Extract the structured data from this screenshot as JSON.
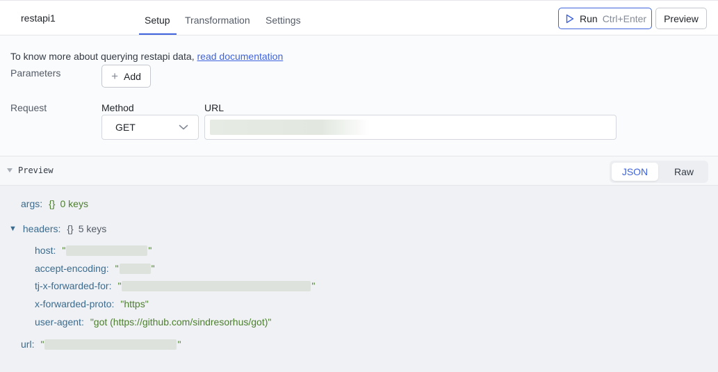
{
  "header": {
    "query_name": "restapi1",
    "tabs": [
      {
        "label": "Setup",
        "active": true
      },
      {
        "label": "Transformation",
        "active": false
      },
      {
        "label": "Settings",
        "active": false
      }
    ],
    "run_label": "Run",
    "run_shortcut": "Ctrl+Enter",
    "preview_label": "Preview"
  },
  "config": {
    "doc_text": "To know more about querying restapi data, ",
    "doc_link": "read documentation",
    "parameters_label": "Parameters",
    "add_label": "Add",
    "request_label": "Request",
    "method_label": "Method",
    "method_value": "GET",
    "url_label": "URL"
  },
  "preview": {
    "toggle_label": "Preview",
    "json_label": "JSON",
    "raw_label": "Raw"
  },
  "json": {
    "args_key": "args",
    "args_brace": "{}",
    "args_count": "0 keys",
    "headers_key": "headers",
    "headers_brace": "{}",
    "headers_count": "5 keys",
    "host_key": "host",
    "accept_key": "accept-encoding",
    "forwarded_for_key": "tj-x-forwarded-for",
    "proto_key": "x-forwarded-proto",
    "proto_value": "\"https\"",
    "ua_key": "user-agent",
    "ua_value": "\"got (https://github.com/sindresorhus/got)\"",
    "url_key": "url"
  },
  "colors": {
    "accent": "#3e63dd",
    "json_key": "#3a6b8f",
    "json_string": "#4b7f2b"
  }
}
